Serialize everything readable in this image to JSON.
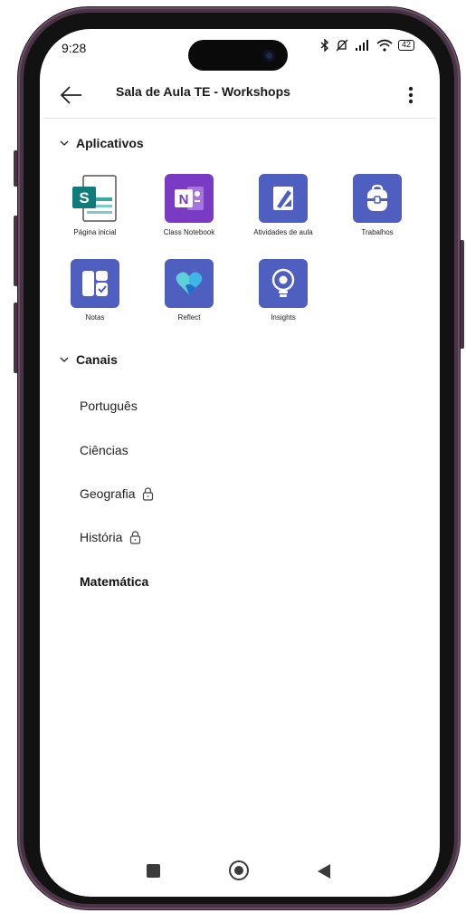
{
  "status_bar": {
    "time": "9:28",
    "battery": "42"
  },
  "app_bar": {
    "title": "Sala de Aula TE - Workshops"
  },
  "apps_section": {
    "label": "Aplicativos",
    "items": [
      {
        "label": "Página inicial",
        "icon": "sharepoint-icon",
        "color": "#0f7b7b"
      },
      {
        "label": "Class Notebook",
        "icon": "onenote-icon",
        "color": "#7b3ac4"
      },
      {
        "label": "Atividades de aula",
        "icon": "assignment-pencil-icon",
        "color": "#4f5fbf"
      },
      {
        "label": "Trabalhos",
        "icon": "backpack-icon",
        "color": "#4f5fbf"
      },
      {
        "label": "Notas",
        "icon": "grades-icon",
        "color": "#4f5fbf"
      },
      {
        "label": "Reflect",
        "icon": "reflect-heart-icon",
        "color": "#4f5fbf"
      },
      {
        "label": "Insights",
        "icon": "lightbulb-icon",
        "color": "#4f5fbf"
      }
    ]
  },
  "channels_section": {
    "label": "Canais",
    "items": [
      {
        "label": "Português",
        "locked": false,
        "bold": false
      },
      {
        "label": "Ciências",
        "locked": false,
        "bold": false
      },
      {
        "label": "Geografia",
        "locked": true,
        "bold": false
      },
      {
        "label": "História",
        "locked": true,
        "bold": false
      },
      {
        "label": "Matemática",
        "locked": false,
        "bold": true
      }
    ]
  }
}
